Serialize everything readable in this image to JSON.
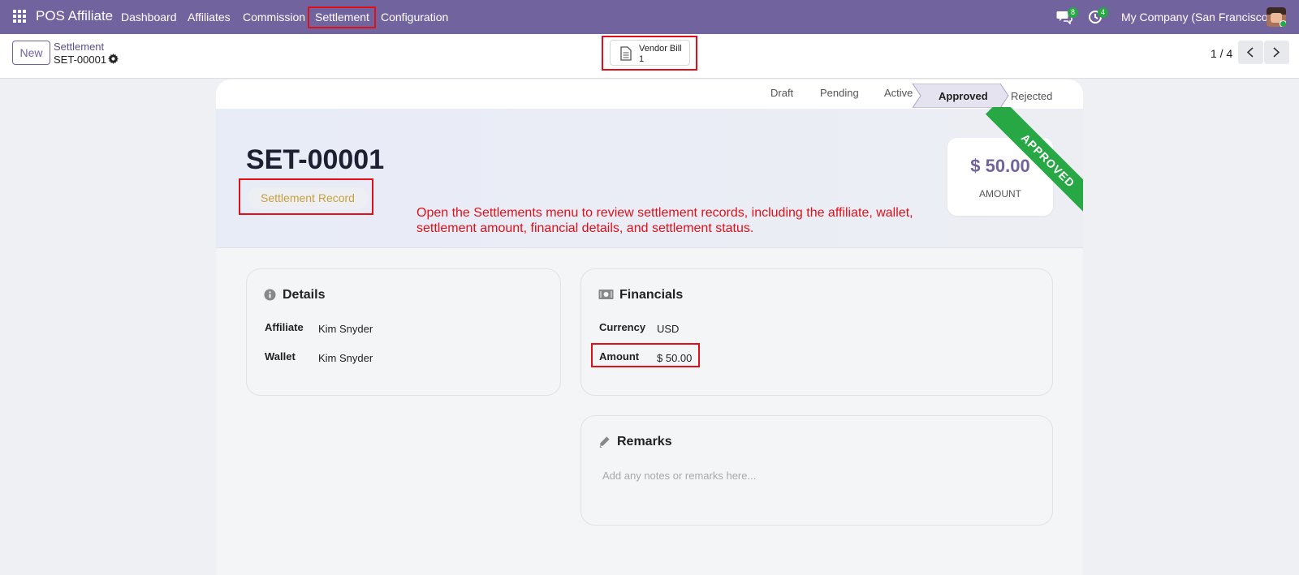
{
  "navbar": {
    "brand": "POS Affiliate",
    "menu": [
      "Dashboard",
      "Affiliates",
      "Commission",
      "Settlement",
      "Configuration"
    ],
    "messages_badge": "8",
    "activity_badge": "4",
    "company": "My Company (San Francisco)"
  },
  "control_panel": {
    "new_label": "New",
    "breadcrumb_parent": "Settlement",
    "breadcrumb_current": "SET-00001",
    "smart_button_label": "Vendor Bill",
    "smart_button_count": "1",
    "pager": "1 / 4"
  },
  "statusbar": {
    "stages": [
      "Draft",
      "Pending",
      "Active",
      "Approved",
      "Rejected"
    ],
    "current": "Approved"
  },
  "record": {
    "title": "SET-00001",
    "tag": "Settlement Record",
    "amount": "$ 50.00",
    "amount_caption": "AMOUNT",
    "ribbon": "APPROVED"
  },
  "annotation": "Open the Settlements menu to review settlement records, including the affiliate, wallet, settlement amount, financial details, and settlement status.",
  "details": {
    "title": "Details",
    "affiliate_label": "Affiliate",
    "affiliate_value": "Kim Snyder",
    "wallet_label": "Wallet",
    "wallet_value": "Kim Snyder"
  },
  "financials": {
    "title": "Financials",
    "currency_label": "Currency",
    "currency_value": "USD",
    "amount_label": "Amount",
    "amount_value": "$ 50.00"
  },
  "remarks": {
    "title": "Remarks",
    "placeholder": "Add any notes or remarks here..."
  },
  "colors": {
    "brand": "#71639e",
    "highlight": "#e0101a",
    "approved": "#28a745",
    "tag": "#c9a03c"
  }
}
